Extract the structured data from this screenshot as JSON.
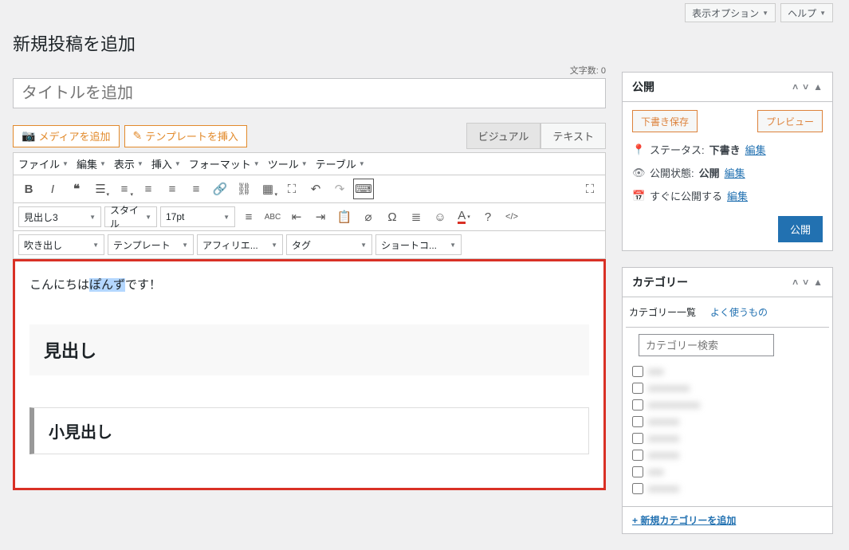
{
  "top": {
    "screen_options": "表示オプション",
    "help": "ヘルプ"
  },
  "page": {
    "title_heading": "新規投稿を追加",
    "char_count_label": "文字数: 0",
    "title_placeholder": "タイトルを追加"
  },
  "mediaBtn": "メディアを追加",
  "templateBtn": "テンプレートを挿入",
  "editorTabs": {
    "visual": "ビジュアル",
    "text": "テキスト"
  },
  "menus": [
    "ファイル",
    "編集",
    "表示",
    "挿入",
    "フォーマット",
    "ツール",
    "テーブル"
  ],
  "format_sel": {
    "heading": "見出し3",
    "style": "スタイル",
    "fontsize": "17pt"
  },
  "row4": [
    "吹き出し",
    "テンプレート",
    "アフィリエ...",
    "タグ",
    "ショートコ..."
  ],
  "content": {
    "line1_a": "こんにちは",
    "line1_hl": "ぽんず",
    "line1_b": "です！",
    "h2": "見出し",
    "h3": "小見出し"
  },
  "publish": {
    "title": "公開",
    "save_draft": "下書き保存",
    "preview": "プレビュー",
    "status_label": "ステータス:",
    "status_val": "下書き",
    "edit": "編集",
    "visibility_label": "公開状態:",
    "visibility_val": "公開",
    "schedule_label": "すぐに公開する",
    "submit": "公開"
  },
  "categories": {
    "title": "カテゴリー",
    "tab_all": "カテゴリー一覧",
    "tab_pop": "よく使うもの",
    "search_ph": "カテゴリー検索",
    "items": [
      "xxx",
      "xxxxxxxx",
      "xxxxxxxxxx",
      "xxxxxx",
      "xxxxxx",
      "xxxxxx",
      "xxx",
      "xxxxxx"
    ],
    "add_new": "+ 新規カテゴリーを追加"
  }
}
